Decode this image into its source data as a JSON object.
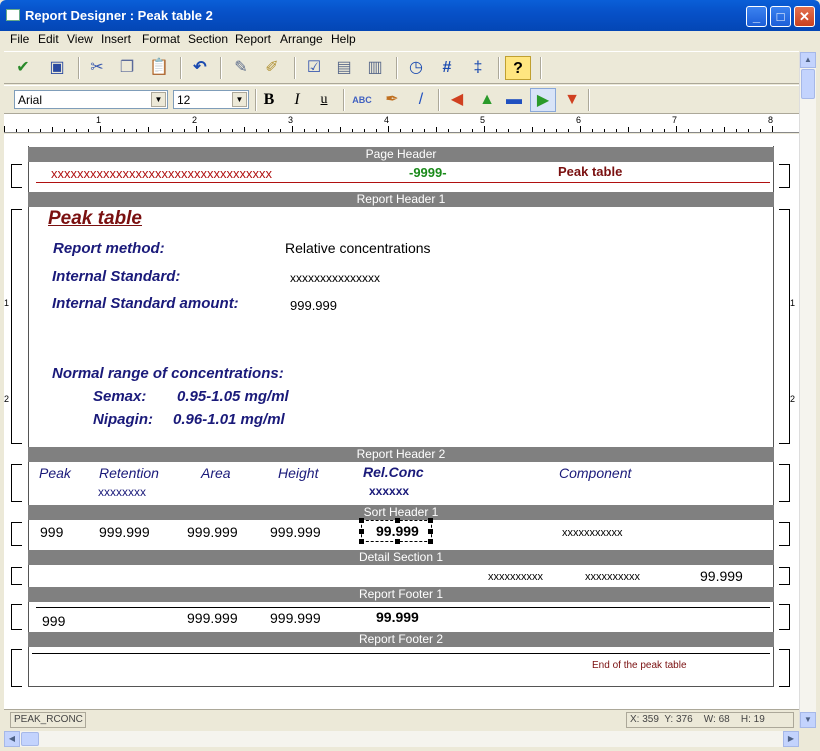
{
  "window": {
    "title": "Report Designer : Peak table 2",
    "min": "_",
    "max": "□",
    "close": "✕"
  },
  "menu": [
    "File",
    "Edit",
    "View",
    "Insert",
    "Format",
    "Section",
    "Report",
    "Arrange",
    "Help"
  ],
  "format_bar": {
    "font": "Arial",
    "size": "12",
    "bold": "B",
    "italic": "I",
    "underline": "u"
  },
  "ruler": [
    "1",
    "2",
    "3",
    "4",
    "5",
    "6",
    "7",
    "8"
  ],
  "bands": {
    "page_header": "Page Header",
    "report_header_1": "Report Header 1",
    "report_header_2": "Report Header 2",
    "sort_header_1": "Sort Header 1",
    "detail_section_1": "Detail Section 1",
    "report_footer_1": "Report Footer 1",
    "report_footer_2": "Report Footer 2"
  },
  "page_header": {
    "left": "xxxxxxxxxxxxxxxxxxxxxxxxxxxxxxxxxx",
    "page": "-9999-",
    "title": "Peak table"
  },
  "report_header_1": {
    "title": "Peak table",
    "method_label": "Report method:",
    "method_value": "Relative concentrations",
    "istd_label": "Internal Standard:",
    "istd_value": "xxxxxxxxxxxxxxx",
    "istd_amount_label": "Internal Standard amount:",
    "istd_amount_value": "999.999",
    "range_label": "Normal range of concentrations:",
    "semax_label": "Semax:",
    "semax_value": "0.95-1.05 mg/ml",
    "nipagin_label": "Nipagin:",
    "nipagin_value": "0.96-1.01 mg/ml"
  },
  "report_header_2": {
    "peak": "Peak",
    "retention": "Retention",
    "retention_sub": "xxxxxxxx",
    "area": "Area",
    "height": "Height",
    "relconc": "Rel.Conc",
    "relconc_sub": "xxxxxx",
    "component": "Component"
  },
  "sort_header_1": {
    "peak": "999",
    "retention": "999.999",
    "area": "999.999",
    "height": "999.999",
    "relconc": "99.999",
    "component": "xxxxxxxxxxx"
  },
  "detail_section_1": {
    "field1": "xxxxxxxxxx",
    "field2": "xxxxxxxxxx",
    "value": "99.999"
  },
  "report_footer_1": {
    "peak": "999",
    "area": "999.999",
    "height": "999.999",
    "relconc": "99.999"
  },
  "report_footer_2": {
    "text": "End of the peak table"
  },
  "status": {
    "field": "PEAK_RCONC",
    "x": "X: 359",
    "y": "Y: 376",
    "w": "W: 68",
    "h": "H: 19"
  }
}
